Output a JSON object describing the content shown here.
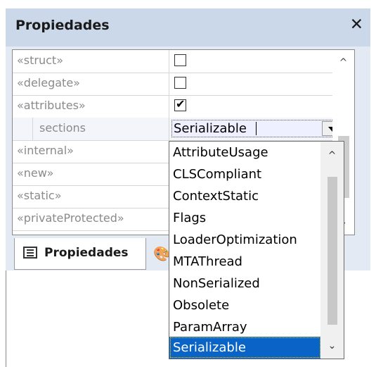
{
  "panel": {
    "title": "Propiedades",
    "close_glyph": "✕"
  },
  "rows": [
    {
      "name": "«struct»",
      "type": "checkbox",
      "checked": false
    },
    {
      "name": "«delegate»",
      "type": "checkbox",
      "checked": false
    },
    {
      "name": "«attributes»",
      "type": "checkbox",
      "checked": true
    },
    {
      "name": "sections",
      "type": "dropdown",
      "value": "Serializable"
    },
    {
      "name": "«internal»"
    },
    {
      "name": "«new»"
    },
    {
      "name": "«static»"
    },
    {
      "name": "«privateProtected»"
    }
  ],
  "tabs": [
    {
      "label": "Propiedades",
      "icon": "properties-icon"
    },
    {
      "label": "",
      "icon": "palette-icon"
    }
  ],
  "dropdown": {
    "options": [
      "AttributeUsage",
      "CLSCompliant",
      "ContextStatic",
      "Flags",
      "LoaderOptimization",
      "MTAThread",
      "NonSerialized",
      "Obsolete",
      "ParamArray",
      "Serializable"
    ],
    "selected": "Serializable"
  },
  "colors": {
    "titlebar": "#cad8ea",
    "selection": "#0a64c8"
  }
}
